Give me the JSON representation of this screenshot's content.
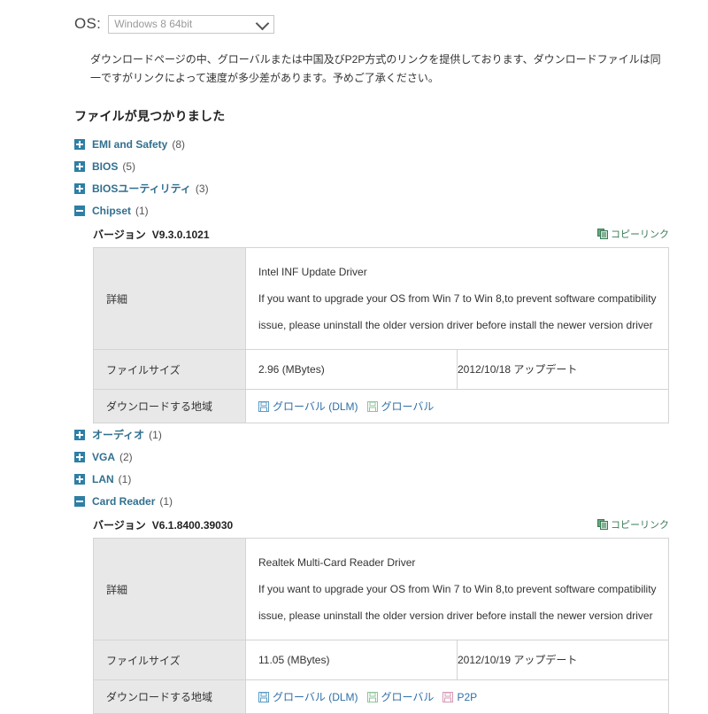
{
  "os": {
    "label": "OS:",
    "selected": "Windows 8 64bit",
    "chevron_icon": "chevron-down-icon"
  },
  "notice": "ダウンロードページの中、グローバルまたは中国及びP2P方式のリンクを提供しております、ダウンロードファイルは同一ですがリンクによって速度が多少差があります。予めご了承ください。",
  "found_heading": "ファイルが見つかりました",
  "categories": [
    {
      "name": "EMI and Safety",
      "count": "(8)",
      "expanded": false
    },
    {
      "name": "BIOS",
      "count": "(5)",
      "expanded": false
    },
    {
      "name": "BIOSユーティリティ",
      "count": "(3)",
      "expanded": false
    },
    {
      "name": "Chipset",
      "count": "(1)",
      "expanded": true
    },
    {
      "name": "オーディオ",
      "count": "(1)",
      "expanded": false
    },
    {
      "name": "VGA",
      "count": "(2)",
      "expanded": false
    },
    {
      "name": "LAN",
      "count": "(1)",
      "expanded": false
    },
    {
      "name": "Card Reader",
      "count": "(1)",
      "expanded": true
    }
  ],
  "labels": {
    "version": "バージョン",
    "copy_link": "コピーリンク",
    "detail": "詳細",
    "file_size": "ファイルサイズ",
    "download_region": "ダウンロードする地域",
    "update_suffix": "アップデート"
  },
  "drivers": [
    {
      "version": "V9.3.0.1021",
      "desc_title": "Intel INF Update Driver",
      "desc_line2": "If you want to upgrade your OS from Win 7 to Win 8,to prevent software compatibility",
      "desc_line3": "issue, please uninstall the older version driver before install the newer version driver",
      "file_size": "2.96 (MBytes)",
      "date": "2012/10/18",
      "downloads": [
        {
          "label": "グローバル (DLM)",
          "color": "#5b9bc4"
        },
        {
          "label": "グローバル",
          "color": "#8fc49a"
        }
      ]
    },
    {
      "version": "V6.1.8400.39030",
      "desc_title": "Realtek Multi-Card Reader Driver",
      "desc_line2": "If you want to upgrade your OS from Win 7 to Win 8,to prevent software compatibility",
      "desc_line3": "issue, please uninstall the older version driver before install the newer version driver",
      "file_size": "11.05 (MBytes)",
      "date": "2012/10/19",
      "downloads": [
        {
          "label": "グローバル (DLM)",
          "color": "#5b9bc4"
        },
        {
          "label": "グローバル",
          "color": "#8fc49a"
        },
        {
          "label": "P2P",
          "color": "#d79ab4"
        }
      ]
    }
  ],
  "colors": {
    "category_link": "#31708f",
    "toggle_box": "#2d7fa5",
    "copy_link_text": "#3a7a55",
    "download_link": "#2f6fa8",
    "label_cell_bg": "#e8e8e8"
  }
}
